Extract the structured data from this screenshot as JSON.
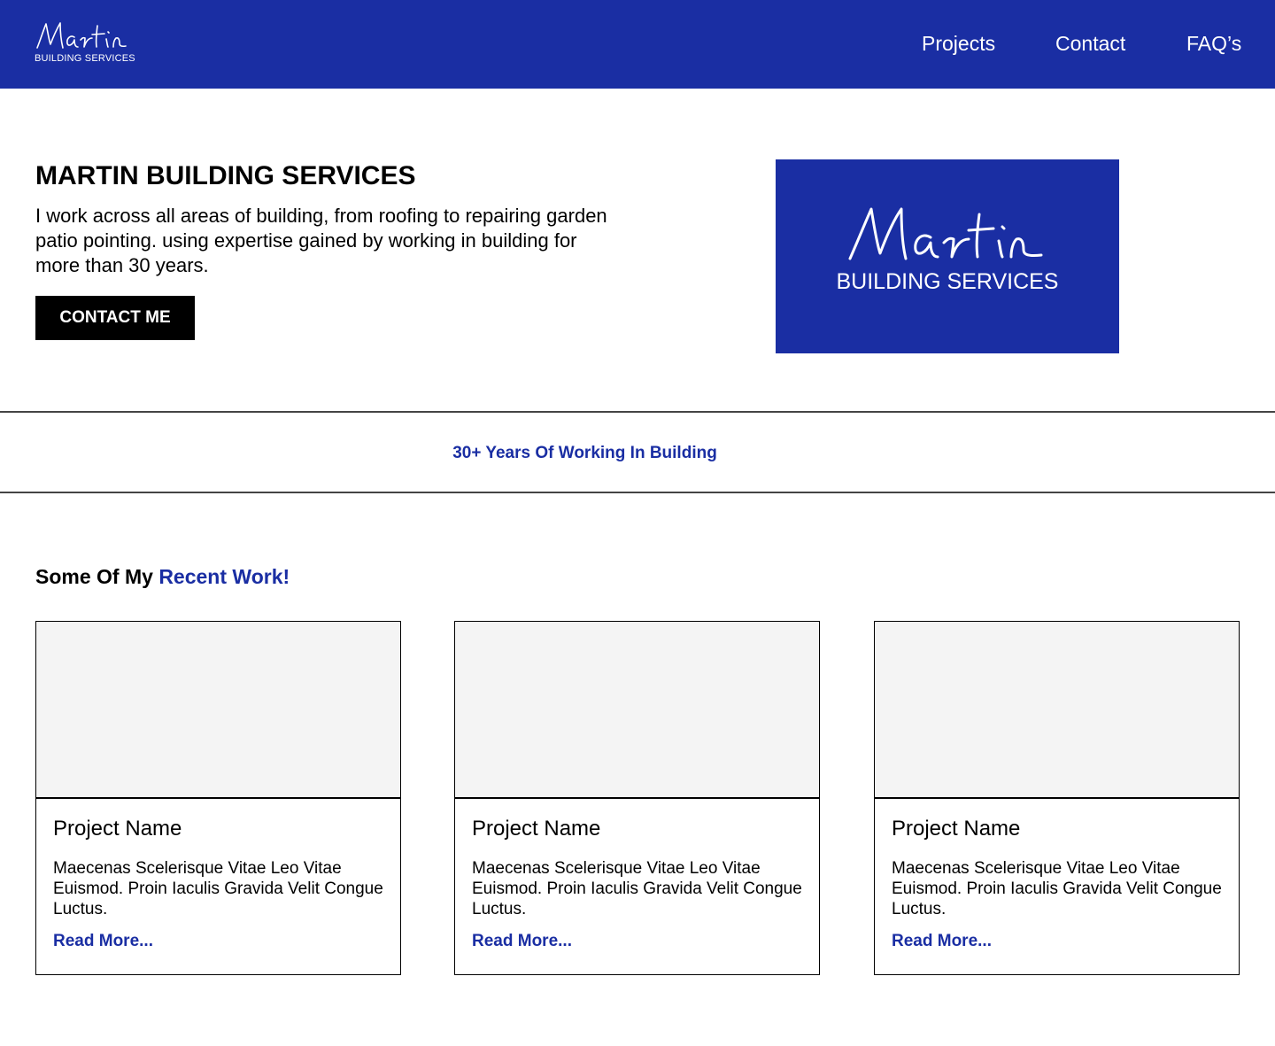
{
  "header": {
    "logo_script": "Martin",
    "logo_subtitle": "BUILDING SERVICES",
    "nav": [
      {
        "label": "Projects"
      },
      {
        "label": "Contact"
      },
      {
        "label": "FAQ’s"
      }
    ]
  },
  "hero": {
    "title": "MARTIN BUILDING SERVICES",
    "text": "I work across all areas of building, from roofing to repairing garden patio pointing. using expertise gained by working in building for more than 30 years.",
    "cta_label": "CONTACT ME",
    "logo_script": "Martin",
    "logo_subtitle": "BUILDING SERVICES"
  },
  "band": {
    "text": "30+ Years Of Working In Building"
  },
  "recent": {
    "title_prefix": "Some Of My ",
    "title_accent": "Recent Work!",
    "cards": [
      {
        "name": "Project Name",
        "description": "Maecenas Scelerisque Vitae Leo Vitae Euismod. Proin Iaculis Gravida Velit Congue Luctus.",
        "link": "Read More..."
      },
      {
        "name": "Project Name",
        "description": "Maecenas Scelerisque Vitae Leo Vitae Euismod. Proin Iaculis Gravida Velit Congue Luctus.",
        "link": "Read More..."
      },
      {
        "name": "Project Name",
        "description": "Maecenas Scelerisque Vitae Leo Vitae Euismod. Proin Iaculis Gravida Velit Congue Luctus.",
        "link": "Read More..."
      }
    ]
  },
  "colors": {
    "brand": "#1a2ea3",
    "text": "#000000",
    "image_placeholder": "#f4f4f4"
  }
}
